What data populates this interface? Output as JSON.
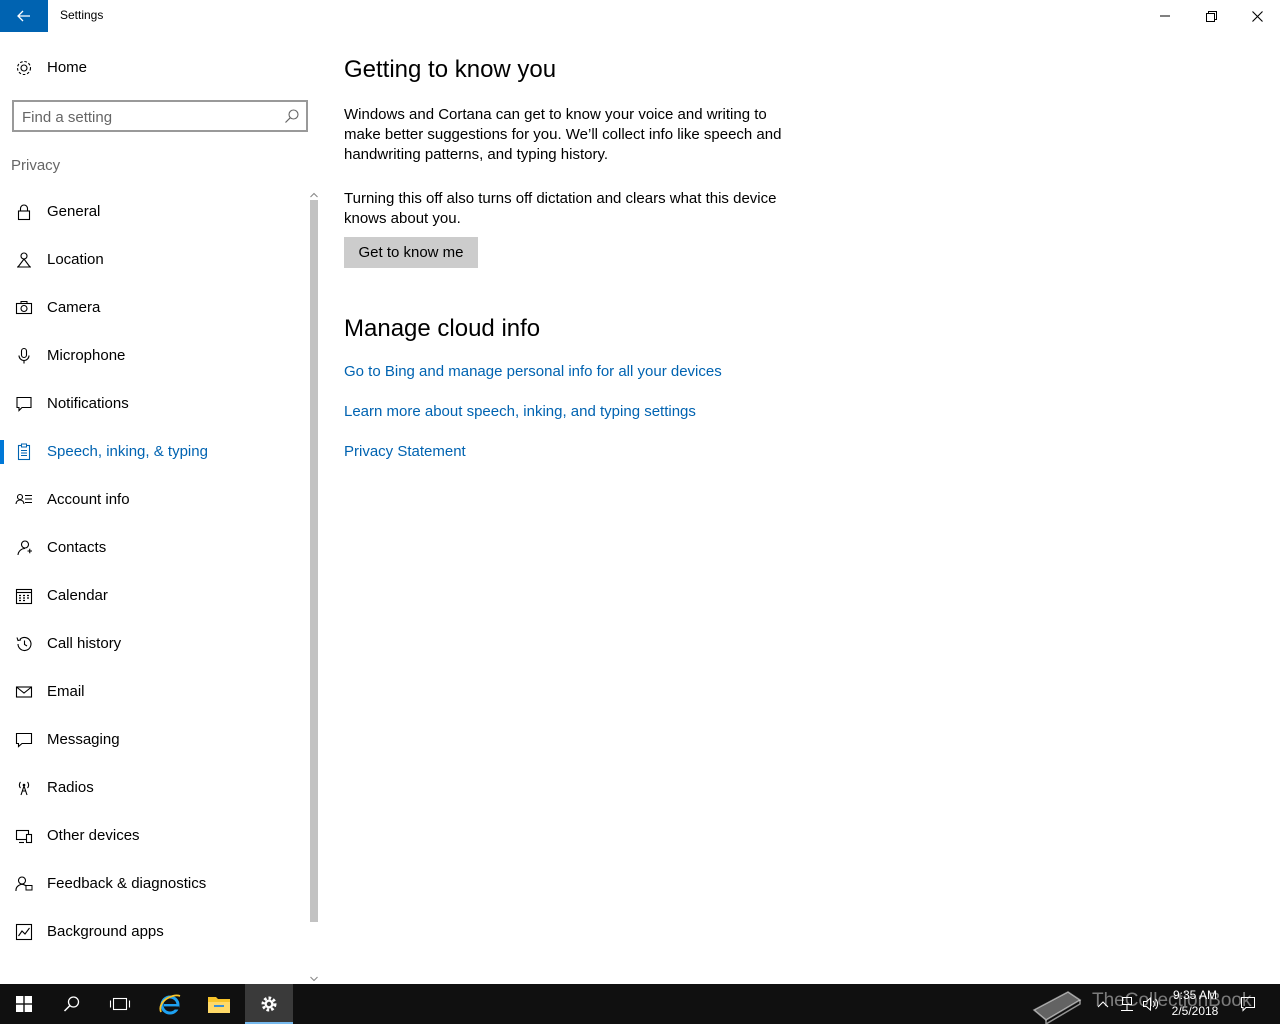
{
  "window": {
    "title": "Settings"
  },
  "sidebar": {
    "home_label": "Home",
    "search_placeholder": "Find a setting",
    "section_label": "Privacy",
    "items": [
      {
        "label": "General",
        "icon": "lock-icon"
      },
      {
        "label": "Location",
        "icon": "location-icon"
      },
      {
        "label": "Camera",
        "icon": "camera-icon"
      },
      {
        "label": "Microphone",
        "icon": "microphone-icon"
      },
      {
        "label": "Notifications",
        "icon": "notifications-icon"
      },
      {
        "label": "Speech, inking, & typing",
        "icon": "clipboard-icon",
        "selected": true
      },
      {
        "label": "Account info",
        "icon": "account-info-icon"
      },
      {
        "label": "Contacts",
        "icon": "contacts-icon"
      },
      {
        "label": "Calendar",
        "icon": "calendar-icon"
      },
      {
        "label": "Call history",
        "icon": "history-icon"
      },
      {
        "label": "Email",
        "icon": "email-icon"
      },
      {
        "label": "Messaging",
        "icon": "messaging-icon"
      },
      {
        "label": "Radios",
        "icon": "radio-tower-icon"
      },
      {
        "label": "Other devices",
        "icon": "other-devices-icon"
      },
      {
        "label": "Feedback & diagnostics",
        "icon": "feedback-icon"
      },
      {
        "label": "Background apps",
        "icon": "background-apps-icon"
      }
    ]
  },
  "content": {
    "section1_title": "Getting to know you",
    "para1": "Windows and Cortana can get to know your voice and writing to make better suggestions for you. We’ll collect info like speech and handwriting patterns, and typing history.",
    "para2": "Turning this off also turns off dictation and clears what this device knows about you.",
    "button_label": "Get to know me",
    "section2_title": "Manage cloud info",
    "links": [
      "Go to Bing and manage personal info for all your devices",
      "Learn more about speech, inking, and typing settings",
      "Privacy Statement"
    ]
  },
  "taskbar": {
    "time": "9:35 AM",
    "date": "2/5/2018",
    "watermark": "TheCollectionBook"
  },
  "colors": {
    "accent": "#0078d7",
    "link": "#0063b1",
    "back_button": "#0063b1",
    "taskbar": "#101010"
  }
}
